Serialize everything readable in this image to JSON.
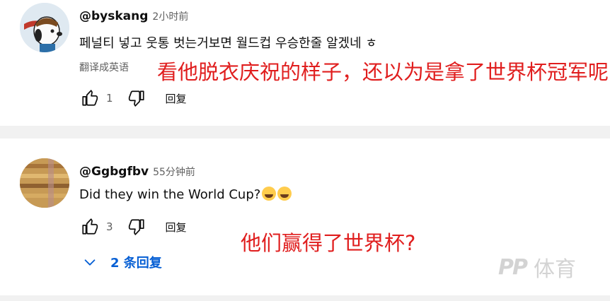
{
  "comments": [
    {
      "user": "@byskang",
      "time": "2小时前",
      "text": "페널티 넣고 웃통 벗는거보면 월드컵 우승한줄 알겠네 ㅎ",
      "translate_label": "翻译成英语",
      "likes": "1",
      "reply_label": "回复",
      "overlay": "看他脱衣庆祝的样子，还以为是拿了世界杯冠军呢"
    },
    {
      "user": "@Ggbgfbv",
      "time": "55分钟前",
      "text": "Did they win the World Cup?",
      "likes": "3",
      "reply_label": "回复",
      "replies_label": "2 条回复",
      "overlay": "他们赢得了世界杯?"
    }
  ],
  "icons": {
    "like": "thumbs-up-icon",
    "dislike": "thumbs-down-icon",
    "expand": "chevron-down-icon",
    "emoji": "laughing-emoji"
  },
  "watermark": {
    "mark": "PP",
    "name": "体育"
  },
  "colors": {
    "link": "#065fd4",
    "overlay": "#e01e1e",
    "secondary": "#606060"
  }
}
